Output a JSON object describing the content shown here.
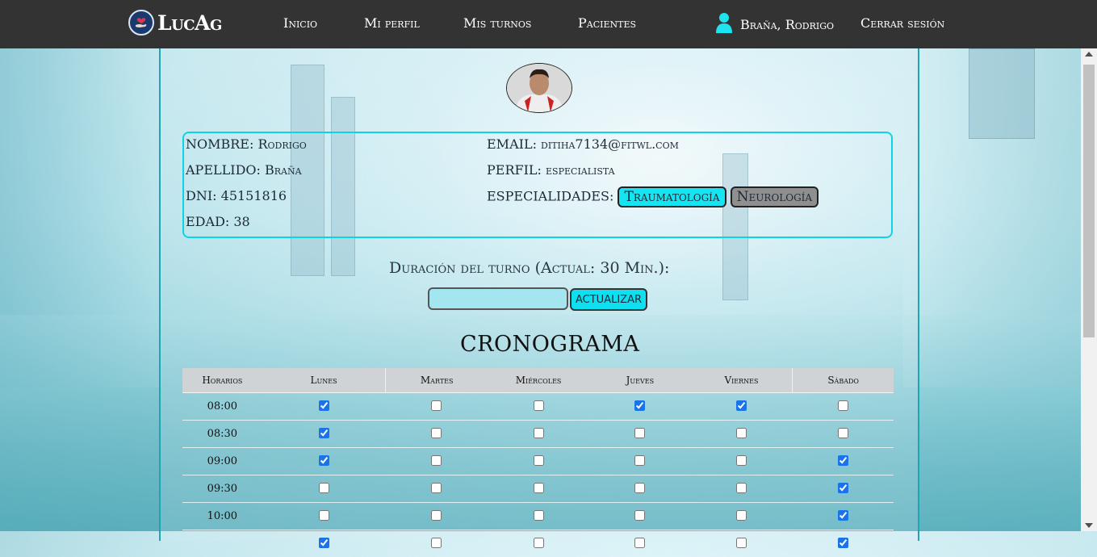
{
  "nav": {
    "brand": "LucAg",
    "links": [
      {
        "label": "Inicio"
      },
      {
        "label": "Mi perfil"
      },
      {
        "label": "Mis turnos"
      },
      {
        "label": "Pacientes"
      }
    ],
    "user_name": "Braña, Rodrigo",
    "logout": "Cerrar sesión",
    "icons": {
      "logo": "heart-hand-logo",
      "user": "user-icon"
    }
  },
  "profile": {
    "nombre_label": "NOMBRE:",
    "nombre": "Rodrigo",
    "apellido_label": "APELLIDO:",
    "apellido": "Braña",
    "dni_label": "DNI:",
    "dni": "45151816",
    "edad_label": "EDAD:",
    "edad": "38",
    "email_label": "EMAIL:",
    "email": "ditiha7134@fitwl.com",
    "perfil_label": "PERFIL:",
    "perfil": "especialista",
    "especialidades_label": "ESPECIALIDADES:",
    "especialidades": [
      {
        "label": "Traumatología",
        "active": true
      },
      {
        "label": "Neurología",
        "active": false
      }
    ]
  },
  "duracion": {
    "label": "Duración del turno (Actual: 30 Min.):",
    "value": "",
    "button": "ACTUALIZAR"
  },
  "cronograma": {
    "title": "CRONOGRAMA",
    "headers": [
      "Horarios",
      "Lunes",
      "Martes",
      "Miércoles",
      "Jueves",
      "Viernes",
      "Sábado"
    ],
    "rows": [
      {
        "hour": "08:00",
        "checks": [
          true,
          false,
          false,
          true,
          true,
          false
        ]
      },
      {
        "hour": "08:30",
        "checks": [
          true,
          false,
          false,
          false,
          false,
          false
        ]
      },
      {
        "hour": "09:00",
        "checks": [
          true,
          false,
          false,
          false,
          false,
          true
        ]
      },
      {
        "hour": "09:30",
        "checks": [
          false,
          false,
          false,
          false,
          false,
          true
        ]
      },
      {
        "hour": "10:00",
        "checks": [
          false,
          false,
          false,
          false,
          false,
          true
        ]
      },
      {
        "hour": "",
        "checks": [
          true,
          false,
          false,
          false,
          false,
          true
        ]
      }
    ]
  },
  "colors": {
    "navbar": "#333333",
    "accent": "#0dd3e6",
    "chip_active": "#15e5f2",
    "chip_inactive": "#8f8f8f"
  }
}
